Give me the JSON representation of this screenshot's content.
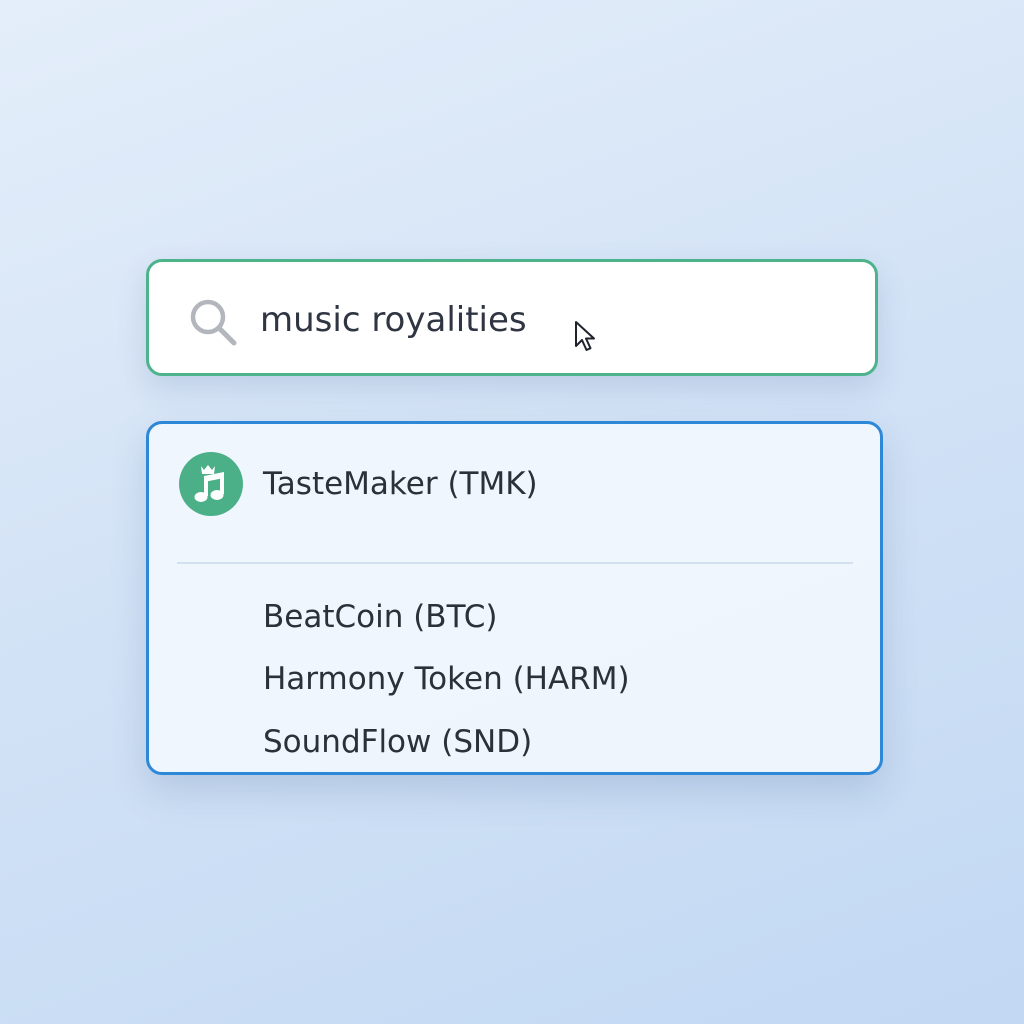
{
  "search": {
    "value": "music royalities"
  },
  "dropdown": {
    "featured": {
      "label": "TasteMaker (TMK)",
      "icon": "music-note-crown-icon",
      "icon_color": "#4bb088"
    },
    "items": [
      {
        "label": "BeatCoin (BTC)"
      },
      {
        "label": "Harmony Token (HARM)"
      },
      {
        "label": "SoundFlow (SND)"
      }
    ]
  },
  "colors": {
    "search_border": "#4db38a",
    "dropdown_border": "#2e88d8"
  }
}
